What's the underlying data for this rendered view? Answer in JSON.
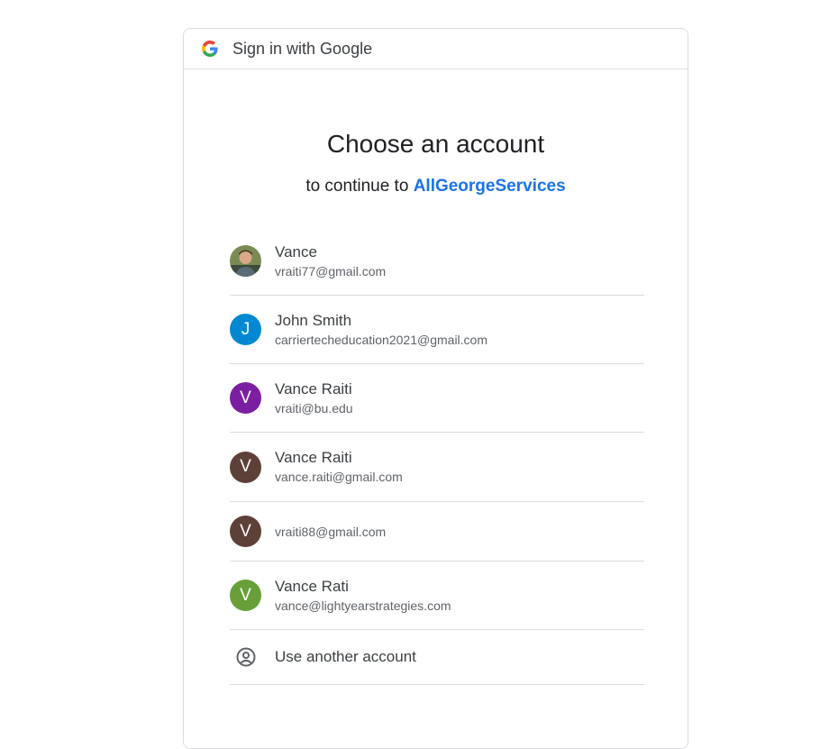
{
  "header": {
    "title": "Sign in with Google",
    "logo_icon": "google-g-icon"
  },
  "heading": "Choose an account",
  "subheading": {
    "prefix": "to continue to ",
    "app_name": "AllGeorgeServices",
    "app_color": "#1a73e8"
  },
  "accounts": [
    {
      "name": "Vance",
      "email": "vraiti77@gmail.com",
      "avatar": "photo",
      "avatar_letter": "",
      "avatar_color": "#6b7d4f"
    },
    {
      "name": "John Smith",
      "email": "carriertecheducation2021@gmail.com",
      "avatar": "letter",
      "avatar_letter": "J",
      "avatar_color": "#0288d1"
    },
    {
      "name": "Vance Raiti",
      "email": "vraiti@bu.edu",
      "avatar": "letter",
      "avatar_letter": "V",
      "avatar_color": "#7b1fa2"
    },
    {
      "name": "Vance Raiti",
      "email": "vance.raiti@gmail.com",
      "avatar": "letter",
      "avatar_letter": "V",
      "avatar_color": "#5d4037"
    },
    {
      "name": "",
      "email": "vraiti88@gmail.com",
      "avatar": "letter",
      "avatar_letter": "V",
      "avatar_color": "#5d4037"
    },
    {
      "name": "Vance Rati",
      "email": "vance@lightyearstrategies.com",
      "avatar": "letter",
      "avatar_letter": "V",
      "avatar_color": "#689f38"
    }
  ],
  "another_account": {
    "label": "Use another account",
    "icon": "account-circle-icon"
  }
}
